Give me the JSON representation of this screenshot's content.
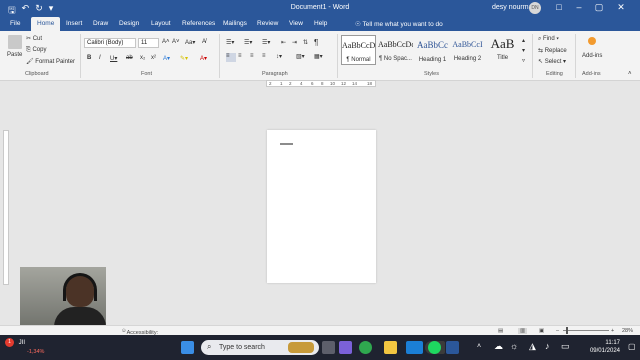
{
  "window": {
    "title": "Document1 - Word",
    "user_name": "desy nourma",
    "avatar_initials": "DN"
  },
  "tabs": [
    "File",
    "Home",
    "Insert",
    "Draw",
    "Design",
    "Layout",
    "References",
    "Mailings",
    "Review",
    "View",
    "Help"
  ],
  "active_tab": "Home",
  "tell_me": "Tell me what you want to do",
  "clipboard": {
    "paste": "Paste",
    "cut": "Cut",
    "copy": "Copy",
    "format_painter": "Format Painter",
    "label": "Clipboard"
  },
  "font": {
    "family": "Calibri (Body)",
    "size": "11",
    "label": "Font"
  },
  "paragraph": {
    "label": "Paragraph"
  },
  "styles": {
    "items": [
      {
        "sample": "AaBbCcDc",
        "name": "¶ Normal"
      },
      {
        "sample": "AaBbCcDc",
        "name": "¶ No Spac..."
      },
      {
        "sample": "AaBbCc",
        "name": "Heading 1"
      },
      {
        "sample": "AaBbCcI",
        "name": "Heading 2"
      },
      {
        "sample": "AaB",
        "name": "Title"
      }
    ],
    "label": "Styles"
  },
  "editing": {
    "find": "Find",
    "replace": "Replace",
    "select": "Select",
    "label": "Editing"
  },
  "addins": {
    "button": "Add-ins",
    "label": "Add-ins"
  },
  "ruler_marks": [
    "2",
    "1",
    "2",
    "4",
    "6",
    "8",
    "10",
    "12",
    "14",
    "18"
  ],
  "statusbar": {
    "accessibility": "Accessibility: Good to go",
    "zoom": "28%"
  },
  "taskbar": {
    "stock_symbol": "JII",
    "stock_change": "-1,34%",
    "stock_badge": "1",
    "search_placeholder": "Type to search",
    "time": "11:17",
    "date": "09/01/2024"
  },
  "colors": {
    "word_blue": "#2b579a",
    "ribbon_bg": "#f3f3f3",
    "taskbar_bg": "#1f2330",
    "stock_down": "#ff6b5e"
  }
}
